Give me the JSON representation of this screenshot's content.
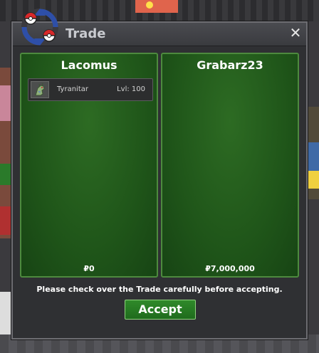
{
  "window": {
    "title": "Trade",
    "close_glyph": "✕"
  },
  "left_panel": {
    "player": "Lacomus",
    "items": [
      {
        "icon": "tyranitar-sprite-icon",
        "name": "Tyranitar",
        "level": "Lvl: 100"
      }
    ],
    "money": "₽0"
  },
  "right_panel": {
    "player": "Grabarz23",
    "items": [],
    "money": "₽7,000,000"
  },
  "notice": "Please check over the Trade carefully before accepting.",
  "accept_label": "Accept",
  "colors": {
    "panel_green": "#1f5519",
    "panel_border": "#4d8a3e",
    "dialog_bg": "#2f3033",
    "accept_green": "#2f8a2a"
  }
}
